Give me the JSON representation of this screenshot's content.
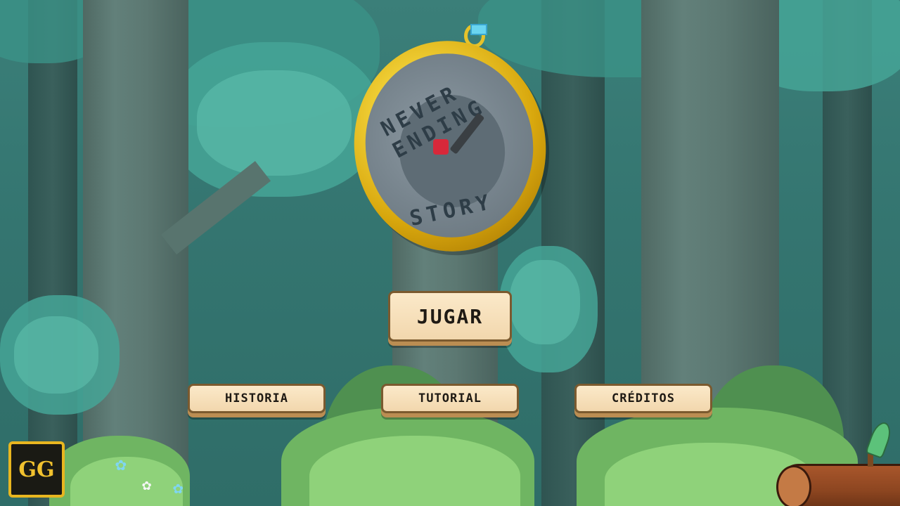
{
  "game": {
    "title_top": "NEVER ENDING",
    "title_bottom": "STORY",
    "menu": {
      "play_label": "JUGAR",
      "history_label": "HISTORIA",
      "tutorial_label": "TUTORIAL",
      "credits_label": "CRÉDITOS"
    },
    "logo_text": "GG"
  },
  "colors": {
    "button_bg": "#f2d7ad",
    "button_border": "#7b5a2f",
    "gold": "#e6c22a",
    "foliage": "#45a597",
    "hand_tip": "#d8283a"
  },
  "icons": {
    "watch": "pocket-watch-icon",
    "logo": "gg-logo-icon",
    "flower": "flower-icon",
    "log": "log-icon",
    "sprout": "sprout-icon"
  }
}
